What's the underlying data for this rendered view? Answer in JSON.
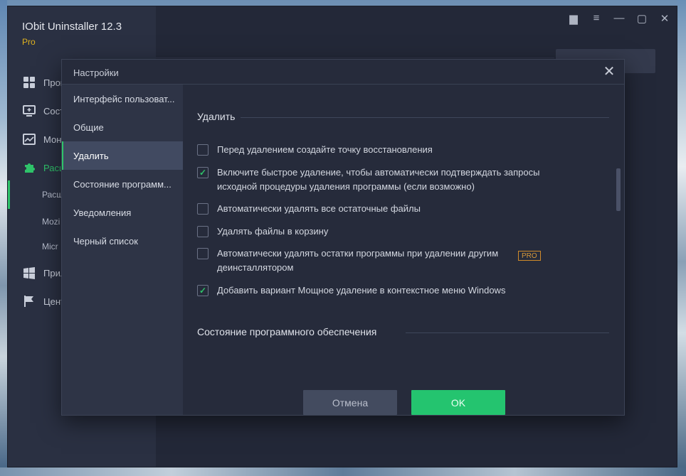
{
  "app": {
    "title": "IObit Uninstaller 12.3",
    "edition": "Pro",
    "nav": [
      {
        "label": "Прог",
        "icon": "grid-icon"
      },
      {
        "label": "Сост",
        "icon": "monitor-icon"
      },
      {
        "label": "Мон",
        "icon": "chart-icon"
      },
      {
        "label": "Расш",
        "icon": "puzzle-icon"
      },
      {
        "label": "Прил",
        "icon": "windows-icon"
      },
      {
        "label": "Цент",
        "icon": "flag-icon"
      }
    ],
    "sub_nav": [
      "Расш",
      "Mozi",
      "Micr"
    ],
    "window_controls": [
      "toolbox-icon",
      "menu-icon",
      "minimize-icon",
      "maximize-icon",
      "close-icon"
    ]
  },
  "dialog": {
    "title": "Настройки",
    "tabs": [
      {
        "label": "Интерфейс пользоват...",
        "active": false
      },
      {
        "label": "Общие",
        "active": false
      },
      {
        "label": "Удалить",
        "active": true
      },
      {
        "label": "Состояние программ...",
        "active": false
      },
      {
        "label": "Уведомления",
        "active": false
      },
      {
        "label": "Черный список",
        "active": false
      }
    ],
    "section_delete": "Удалить",
    "options": [
      {
        "label": "Перед удалением создайте точку восстановления",
        "checked": false,
        "pro": false
      },
      {
        "label": "Включите быстрое удаление, чтобы автоматически подтверждать запросы исходной процедуры удаления программы (если возможно)",
        "checked": true,
        "pro": false
      },
      {
        "label": "Автоматически удалять все остаточные файлы",
        "checked": false,
        "pro": false
      },
      {
        "label": "Удалять файлы в корзину",
        "checked": false,
        "pro": false
      },
      {
        "label": "Автоматически удалять остатки программы при удалении другим деинсталлятором",
        "checked": false,
        "pro": true
      },
      {
        "label": "Добавить вариант Мощное удаление в контекстное меню Windows",
        "checked": true,
        "pro": false
      }
    ],
    "pro_badge": "PRO",
    "section_status": "Состояние программного обеспечения",
    "cancel_label": "Отмена",
    "ok_label": "OK"
  },
  "colors": {
    "accent": "#24c46f",
    "pro_badge": "#d99a3a",
    "dialog_bg": "#262b3b"
  }
}
